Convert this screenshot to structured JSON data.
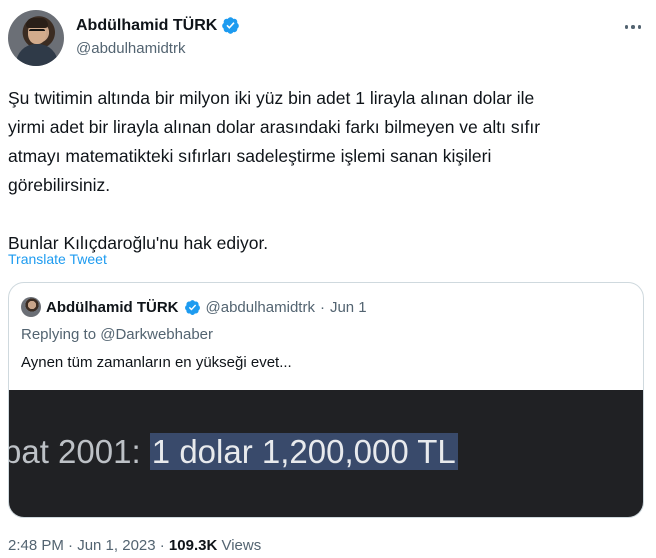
{
  "author": {
    "name": "Abdülhamid TÜRK",
    "handle": "@abdulhamidtrk",
    "verified_color": "#1d9bf0"
  },
  "icons": {
    "more": "more-horizontal-icon",
    "verified": "verified-badge-icon"
  },
  "tweet": {
    "text": "Şu twitimin altında bir milyon iki yüz bin adet 1 lirayla alınan dolar ile\nyirmi adet bir lirayla alınan dolar arasındaki farkı bilmeyen ve altı sıfır\natmayı matematikteki sıfırları sadeleştirme işlemi sanan kişileri\ngörebilirsiniz.\n\nBunlar Kılıçdaroğlu'nu hak ediyor.",
    "translate_label": "Translate Tweet"
  },
  "quote": {
    "name": "Abdülhamid TÜRK",
    "handle": "@abdulhamidtrk",
    "separator": "·",
    "date": "Jun 1",
    "replying_prefix": "Replying to ",
    "replying_to": "@Darkwebhaber",
    "text": "Aynen tüm zamanların en yükseği evet...",
    "media": {
      "prefix": "bat 2001: ",
      "highlight": "1 dolar 1,200,000 TL"
    }
  },
  "meta": {
    "time_date": "2:48 PM · Jun 1, 2023 · ",
    "views_count": "109.3K",
    "views_label": " Views"
  }
}
